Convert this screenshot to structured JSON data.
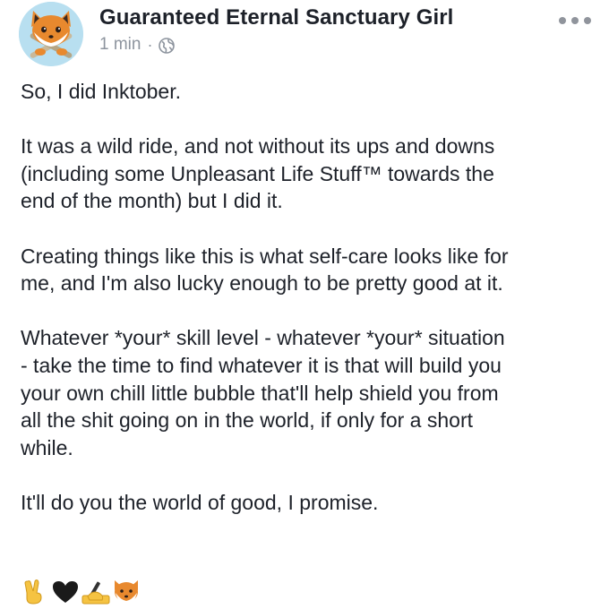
{
  "post": {
    "author_name": "Guaranteed Eternal Sanctuary Girl",
    "timestamp": "1 min",
    "separator": "·",
    "privacy_icon": "globe-icon",
    "more_icon": "more-options-icon",
    "paragraphs": [
      "So, I did Inktober.",
      "It was a wild ride, and not without its ups and downs\n(including some Unpleasant Life Stuff™ towards the\nend of the month) but I did it.",
      "Creating things like this is what self-care looks like for\nme, and I'm also lucky enough to be pretty good at it.",
      "Whatever *your* skill level - whatever *your* situation\n- take the time to find whatever it is that will build you\nyour own chill little bubble that'll help shield you from\nall the shit going on in the world, if only for a short\nwhile.",
      "It'll do you the world of good, I promise."
    ],
    "emojis": [
      "victory-hand-emoji",
      "black-heart-emoji",
      "writing-hand-emoji",
      "fox-face-emoji"
    ]
  },
  "colors": {
    "text": "#1d2129",
    "meta": "#8d949e",
    "avatar_bg": "#b8dff0",
    "fox_orange": "#e8892e"
  }
}
